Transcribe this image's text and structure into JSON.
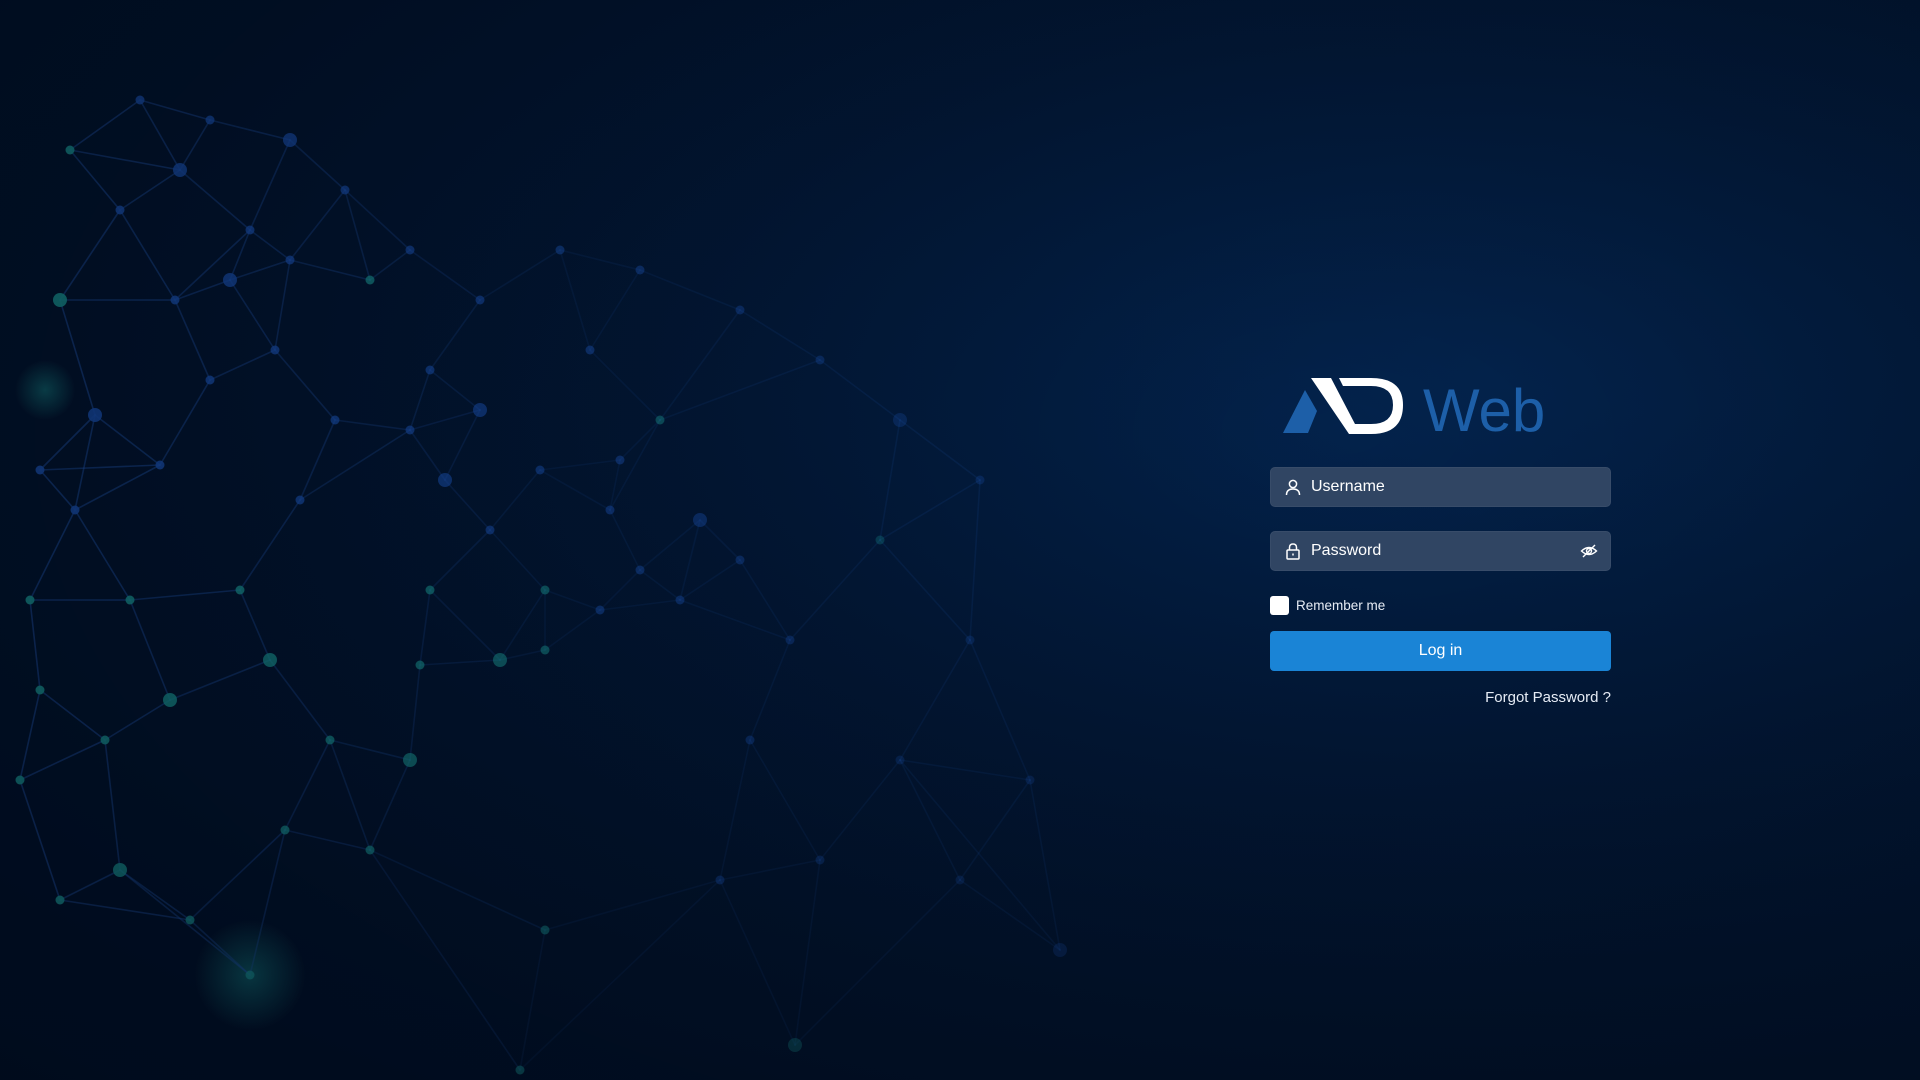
{
  "brand": {
    "logo_icon": "ad-logo-mark",
    "logo_word": "Web",
    "colors": {
      "mark_white": "#ffffff",
      "mark_blue": "#1d5fa8",
      "word_blue": "#1d5fa8"
    }
  },
  "login": {
    "username": {
      "icon": "user-icon",
      "placeholder": "Username",
      "value": ""
    },
    "password": {
      "icon": "lock-icon",
      "placeholder": "Password",
      "value": "",
      "toggle_icon": "eye-off-icon"
    },
    "remember": {
      "label": "Remember me",
      "checked": false
    },
    "submit_label": "Log in",
    "forgot_label": "Forgot Password ?"
  },
  "theme": {
    "background": "#021a3c",
    "field_bg": "#304563",
    "button_bg": "#1a84d6",
    "network_blue": "#1f5fd0",
    "network_teal": "#1fb6b0"
  }
}
